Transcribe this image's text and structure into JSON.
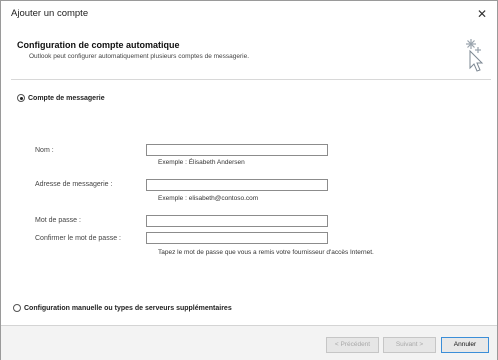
{
  "window": {
    "title": "Ajouter un compte",
    "close_glyph": "✕"
  },
  "header": {
    "title": "Configuration de compte automatique",
    "subtitle": "Outlook peut configurer automatiquement plusieurs comptes de messagerie.",
    "icon": "wizard-wand-icon"
  },
  "email_account_option": {
    "label": "Compte de messagerie",
    "selected": true
  },
  "form": {
    "name": {
      "label": "Nom :",
      "value": "",
      "hint": "Exemple : Élisabeth Andersen"
    },
    "email": {
      "label": "Adresse de messagerie :",
      "value": "",
      "hint": "Exemple : elisabeth@contoso.com"
    },
    "password": {
      "label": "Mot de passe :",
      "value": ""
    },
    "confirm_password": {
      "label": "Confirmer le mot de passe :",
      "value": ""
    },
    "password_hint": "Tapez le mot de passe que vous a remis votre fournisseur d'accès Internet."
  },
  "manual_option": {
    "label": "Configuration manuelle ou types de serveurs supplémentaires",
    "selected": false
  },
  "buttons": {
    "previous": "< Précédent",
    "next": "Suivant >",
    "cancel": "Annuler"
  },
  "colors": {
    "accent": "#3b8ed8",
    "disabled_text": "#a8a8a8"
  }
}
